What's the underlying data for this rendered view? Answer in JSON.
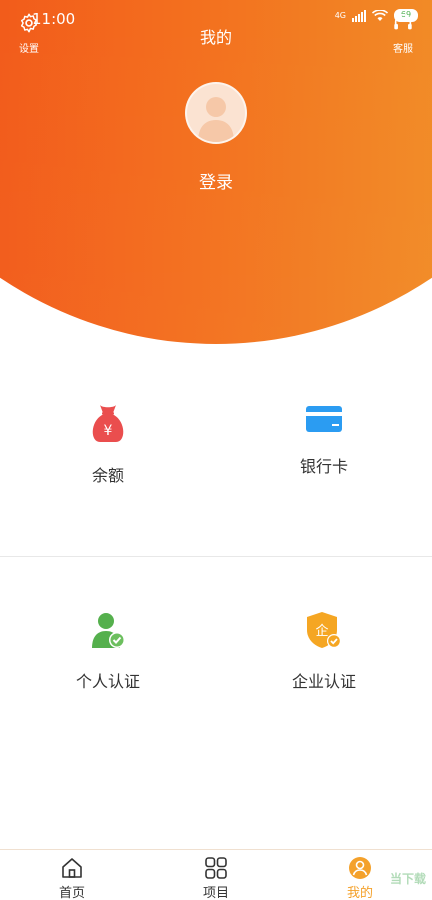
{
  "status_bar": {
    "time": "11:00",
    "network": "4G",
    "battery": "69"
  },
  "header": {
    "title": "我的",
    "settings_label": "设置",
    "support_label": "客服",
    "login_label": "登录"
  },
  "grid": [
    {
      "label": "余额",
      "icon": "money-bag-icon"
    },
    {
      "label": "银行卡",
      "icon": "bank-card-icon"
    },
    {
      "label": "个人认证",
      "icon": "personal-verify-icon"
    },
    {
      "label": "企业认证",
      "icon": "enterprise-verify-icon"
    }
  ],
  "tabbar": [
    {
      "label": "首页",
      "icon": "home-icon"
    },
    {
      "label": "项目",
      "icon": "grid-icon"
    },
    {
      "label": "我的",
      "icon": "user-icon",
      "active": true
    }
  ],
  "colors": {
    "gradient_start": "#f24817",
    "gradient_end": "#f0a02d",
    "active_tab": "#f4a12b",
    "balance_icon": "#ea4e4e",
    "bank_icon": "#2b9cf2",
    "personal_icon": "#55b04d",
    "enterprise_icon": "#f5a623"
  },
  "watermark": "当下载"
}
